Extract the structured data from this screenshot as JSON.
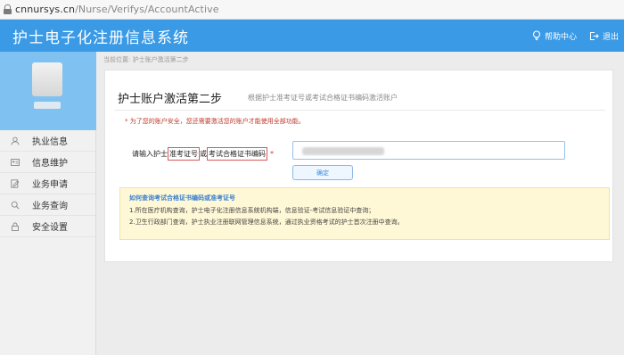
{
  "browser": {
    "url_host": "cnnursys.cn",
    "url_path": "/Nurse/Verifys/AccountActive"
  },
  "header": {
    "title": "护士电子化注册信息系统",
    "help_label": "帮助中心",
    "logout_label": "退出"
  },
  "sidebar": {
    "items": [
      {
        "label": "执业信息",
        "icon": "user-icon"
      },
      {
        "label": "信息维护",
        "icon": "id-card-icon"
      },
      {
        "label": "业务申请",
        "icon": "edit-doc-icon"
      },
      {
        "label": "业务查询",
        "icon": "search-icon"
      },
      {
        "label": "安全设置",
        "icon": "lock-icon"
      }
    ]
  },
  "main": {
    "breadcrumb": "当前位置: 护士账户激活第二步",
    "title": "护士账户激活第二步",
    "subtitle": "根据护士准考证号或考试合格证书编码激活账户",
    "notice": "* 为了您的账户安全，您还需要激活您的账户才能使用全部功能。",
    "form": {
      "label_prefix": "请输入护士",
      "label_box1": "准考证号",
      "label_mid": "或",
      "label_box2": "考试合格证书编码",
      "required_mark": "*",
      "confirm_label": "确定"
    },
    "help": {
      "title": "如何查询考试合格证书编码或准考证号",
      "line1": "1.所在医疗机构查询，护士电子化注册信息系统机构端，信息验证-考试信息验证中查询；",
      "line2": "2.卫生行政部门查询，护士执业注册联网管理信息系统，通过执业资格考试的护士首次注册中查询。"
    }
  },
  "colors": {
    "header_bg": "#3a9ae6",
    "sidebar_profile_bg": "#7fc1f0",
    "notice_red": "#c0392b",
    "help_bg": "#fff8d6",
    "help_title": "#3a7fcf"
  }
}
